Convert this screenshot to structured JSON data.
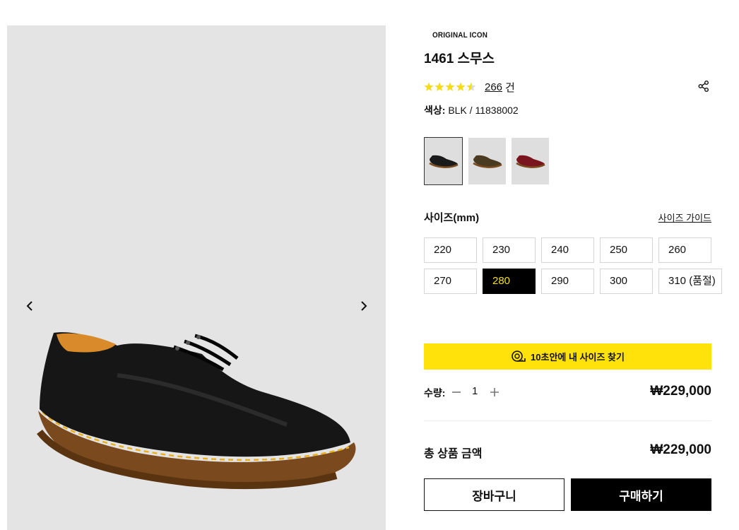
{
  "gallery": {
    "prev_icon": "chevron-left-icon",
    "next_icon": "chevron-right-icon",
    "image": "black-derby-shoe"
  },
  "product": {
    "tag": "ORIGINAL ICON",
    "title": "1461 스무스",
    "rating": 4.5,
    "rating_max": 5,
    "review_count": "266",
    "review_unit": "건",
    "color_label": "색상:",
    "color_value": " BLK / 11838002"
  },
  "swatches": [
    {
      "name": "black",
      "selected": true,
      "color": "#1a1a1a"
    },
    {
      "name": "brown",
      "selected": false,
      "color": "#4a3a22"
    },
    {
      "name": "cherry-red",
      "selected": false,
      "color": "#7a1520"
    }
  ],
  "sizes": {
    "title": "사이즈(mm)",
    "guide_label": "사이즈 가이드",
    "options": [
      "220",
      "230",
      "240",
      "250",
      "260",
      "270",
      "280",
      "290",
      "300",
      "310 (품절)"
    ],
    "selected": "280"
  },
  "finder": {
    "label": "10초안에 내 사이즈 찾기",
    "icon": "measuring-tape-icon"
  },
  "quantity": {
    "label": "수량:",
    "value": "1",
    "unit_price": "₩229,000"
  },
  "total": {
    "label": "총 상품 금액",
    "price": "₩229,000"
  },
  "actions": {
    "cart_label": "장바구니",
    "buy_label": "구매하기"
  },
  "colors": {
    "accent_yellow": "#ffe20a",
    "selected_text": "#f6df1a",
    "star_yellow": "#f5dc14",
    "gallery_bg": "#e4e4e4"
  }
}
